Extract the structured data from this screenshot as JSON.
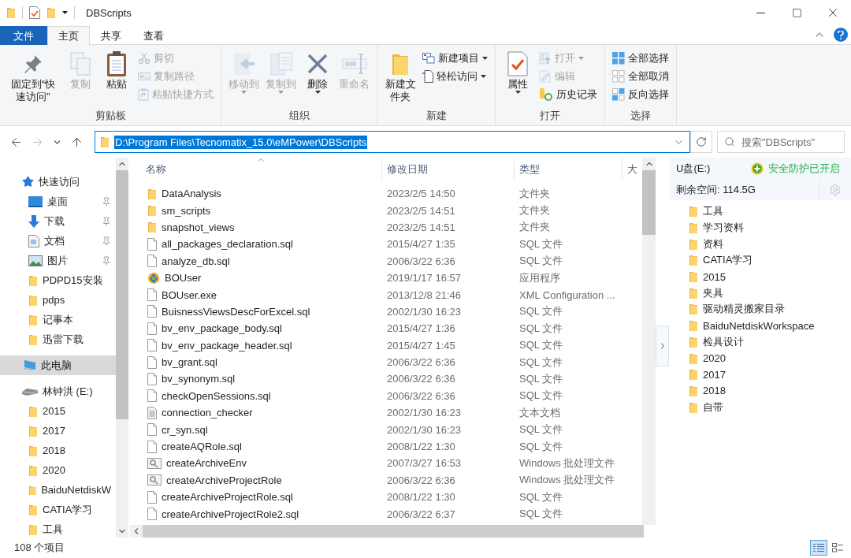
{
  "window": {
    "title": "DBScripts"
  },
  "ribbon": {
    "tabs": [
      {
        "label": "文件",
        "kind": "file",
        "selected": false
      },
      {
        "label": "主页",
        "kind": "tab",
        "selected": true
      },
      {
        "label": "共享",
        "kind": "tab",
        "selected": false
      },
      {
        "label": "查看",
        "kind": "tab",
        "selected": false
      }
    ],
    "groups": [
      {
        "label": "剪贴板",
        "items": [
          {
            "label": "固定到“快速访问”",
            "kind": "large",
            "disabled": false,
            "dropdown": false
          },
          {
            "label": "复制",
            "kind": "large",
            "disabled": true,
            "dropdown": false
          },
          {
            "label": "粘贴",
            "kind": "large",
            "disabled": false,
            "dropdown": false
          },
          {
            "label": "剪切",
            "kind": "small",
            "disabled": true,
            "dropdown": false
          },
          {
            "label": "复制路径",
            "kind": "small",
            "disabled": true,
            "dropdown": false
          },
          {
            "label": "粘贴快捷方式",
            "kind": "small",
            "disabled": true,
            "dropdown": false
          }
        ]
      },
      {
        "label": "组织",
        "items": [
          {
            "label": "移动到",
            "kind": "large",
            "disabled": true,
            "dropdown": true
          },
          {
            "label": "复制到",
            "kind": "large",
            "disabled": true,
            "dropdown": true
          },
          {
            "label": "删除",
            "kind": "large",
            "disabled": false,
            "dropdown": true
          },
          {
            "label": "重命名",
            "kind": "large",
            "disabled": true,
            "dropdown": false
          }
        ]
      },
      {
        "label": "新建",
        "items": [
          {
            "label": "新建文件夹",
            "kind": "large",
            "disabled": false,
            "dropdown": false
          },
          {
            "label": "新建项目",
            "kind": "small",
            "disabled": false,
            "dropdown": true
          },
          {
            "label": "轻松访问",
            "kind": "small",
            "disabled": false,
            "dropdown": true
          }
        ]
      },
      {
        "label": "打开",
        "items": [
          {
            "label": "属性",
            "kind": "large",
            "disabled": false,
            "dropdown": true
          },
          {
            "label": "打开",
            "kind": "small",
            "disabled": true,
            "dropdown": true
          },
          {
            "label": "编辑",
            "kind": "small",
            "disabled": true,
            "dropdown": false
          },
          {
            "label": "历史记录",
            "kind": "small",
            "disabled": false,
            "dropdown": false
          }
        ]
      },
      {
        "label": "选择",
        "items": [
          {
            "label": "全部选择",
            "kind": "small",
            "disabled": false,
            "dropdown": false
          },
          {
            "label": "全部取消",
            "kind": "small",
            "disabled": false,
            "dropdown": false
          },
          {
            "label": "反向选择",
            "kind": "small",
            "disabled": false,
            "dropdown": false
          }
        ]
      }
    ]
  },
  "address": {
    "path": "D:\\Program Files\\Tecnomatix_15.0\\eMPower\\DBScripts",
    "selected": true
  },
  "search": {
    "placeholder": "搜索\"DBScripts\""
  },
  "navigation": [
    {
      "label": "快速访问",
      "kind": "quick",
      "selected": false,
      "children": [
        {
          "label": "桌面",
          "kind": "desktop",
          "pinned": true,
          "selected": false
        },
        {
          "label": "下载",
          "kind": "download",
          "pinned": true,
          "selected": false
        },
        {
          "label": "文档",
          "kind": "docs",
          "pinned": true,
          "selected": false
        },
        {
          "label": "图片",
          "kind": "pictures",
          "pinned": true,
          "selected": false
        },
        {
          "label": "PDPD15安装",
          "kind": "folder",
          "pinned": false,
          "selected": false
        },
        {
          "label": "pdps",
          "kind": "folder",
          "pinned": false,
          "selected": false
        },
        {
          "label": "记事本",
          "kind": "folder",
          "pinned": false,
          "selected": false
        },
        {
          "label": "迅雷下载",
          "kind": "folder",
          "pinned": false,
          "selected": false
        }
      ]
    },
    {
      "label": "此电脑",
      "kind": "pc",
      "selected": true
    },
    {
      "label": "林钟洪 (E:)",
      "kind": "drive",
      "selected": false,
      "children": [
        {
          "label": "2015",
          "kind": "folder",
          "pinned": false,
          "selected": false
        },
        {
          "label": "2017",
          "kind": "folder",
          "pinned": false,
          "selected": false
        },
        {
          "label": "2018",
          "kind": "folder",
          "pinned": false,
          "selected": false
        },
        {
          "label": "2020",
          "kind": "folder",
          "pinned": false,
          "selected": false
        },
        {
          "label": "BaiduNetdiskW",
          "kind": "folder",
          "pinned": false,
          "selected": false
        },
        {
          "label": "CATIA学习",
          "kind": "folder",
          "pinned": false,
          "selected": false
        },
        {
          "label": "工具",
          "kind": "folder",
          "pinned": false,
          "selected": false
        }
      ]
    }
  ],
  "file_list": {
    "columns": [
      "名称",
      "修改日期",
      "类型",
      "大"
    ],
    "rows": [
      {
        "name": "DataAnalysis",
        "date": "2023/2/5 14:50",
        "type": "文件夹",
        "kind": "folder"
      },
      {
        "name": "sm_scripts",
        "date": "2023/2/5 14:51",
        "type": "文件夹",
        "kind": "folder"
      },
      {
        "name": "snapshot_views",
        "date": "2023/2/5 14:51",
        "type": "文件夹",
        "kind": "folder"
      },
      {
        "name": "all_packages_declaration.sql",
        "date": "2015/4/27 1:35",
        "type": "SQL 文件",
        "kind": "file"
      },
      {
        "name": "analyze_db.sql",
        "date": "2006/3/22 6:36",
        "type": "SQL 文件",
        "kind": "file"
      },
      {
        "name": "BOUser",
        "date": "2019/1/17 16:57",
        "type": "应用程序",
        "kind": "app"
      },
      {
        "name": "BOUser.exe",
        "date": "2013/12/8 21:46",
        "type": "XML Configuration ...",
        "kind": "file"
      },
      {
        "name": "BuisnessViewsDescForExcel.sql",
        "date": "2002/1/30 16:23",
        "type": "SQL 文件",
        "kind": "file"
      },
      {
        "name": "bv_env_package_body.sql",
        "date": "2015/4/27 1:36",
        "type": "SQL 文件",
        "kind": "file"
      },
      {
        "name": "bv_env_package_header.sql",
        "date": "2015/4/27 1:45",
        "type": "SQL 文件",
        "kind": "file"
      },
      {
        "name": "bv_grant.sql",
        "date": "2006/3/22 6:36",
        "type": "SQL 文件",
        "kind": "file"
      },
      {
        "name": "bv_synonym.sql",
        "date": "2006/3/22 6:36",
        "type": "SQL 文件",
        "kind": "file"
      },
      {
        "name": "checkOpenSessions.sql",
        "date": "2006/3/22 6:36",
        "type": "SQL 文件",
        "kind": "file"
      },
      {
        "name": "connection_checker",
        "date": "2002/1/30 16:23",
        "type": "文本文档",
        "kind": "text"
      },
      {
        "name": "cr_syn.sql",
        "date": "2002/1/30 16:23",
        "type": "SQL 文件",
        "kind": "file"
      },
      {
        "name": "createAQRole.sql",
        "date": "2008/1/22 1:30",
        "type": "SQL 文件",
        "kind": "file"
      },
      {
        "name": "createArchiveEnv",
        "date": "2007/3/27 16:53",
        "type": "Windows 批处理文件",
        "kind": "batch"
      },
      {
        "name": "createArchiveProjectRole",
        "date": "2006/3/22 6:36",
        "type": "Windows 批处理文件",
        "kind": "batch"
      },
      {
        "name": "createArchiveProjectRole.sql",
        "date": "2008/1/22 1:30",
        "type": "SQL 文件",
        "kind": "file"
      },
      {
        "name": "createArchiveProjectRole2.sql",
        "date": "2006/3/22 6:37",
        "type": "SQL 文件",
        "kind": "file"
      }
    ]
  },
  "drive_panel": {
    "drive": "U盘(E:)",
    "status": "安全防护已开启",
    "free_space": "剩余空间: 114.5G",
    "folders": [
      "工具",
      "学习资料",
      "资料",
      "CATIA学习",
      "2015",
      "夹具",
      "驱动精灵搬家目录",
      "BaiduNetdiskWorkspace",
      "检具设计",
      "2020",
      "2017",
      "2018",
      "自带"
    ]
  },
  "status_bar": {
    "count": "108 个项目",
    "views": [
      {
        "kind": "details",
        "selected": true
      },
      {
        "kind": "tiles",
        "selected": false
      }
    ]
  }
}
